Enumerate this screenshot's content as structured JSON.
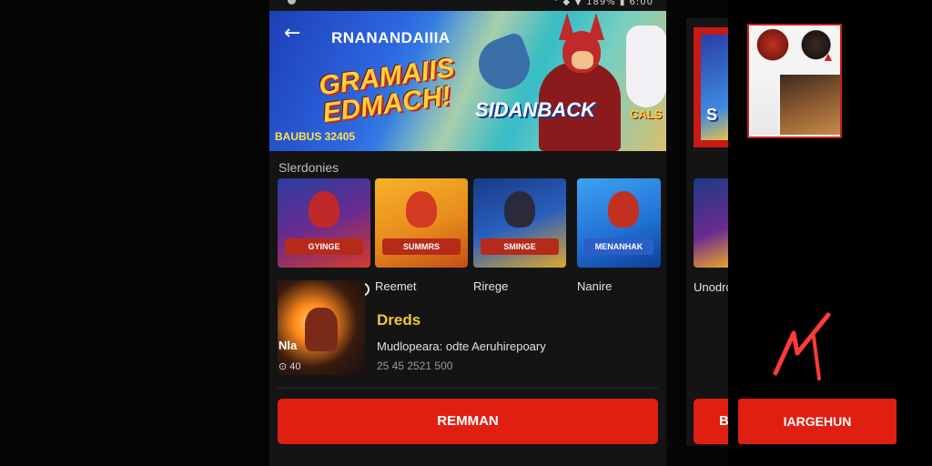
{
  "status_bar": {
    "right_text": "° ◆ ▼ 189% ▮ 6:00"
  },
  "header": {
    "back_icon": "arrow-left-icon",
    "title": "RNANANDAIIIA"
  },
  "banner": {
    "logo_left": "GRAMAIIS\nEDMACH!",
    "logo_right": "SIDANBACK",
    "logo_tag": "CALS",
    "subtitle": "BAUBUS 32405"
  },
  "section": {
    "label": "Slerdonies"
  },
  "games": [
    {
      "badge": "GYINGE",
      "label": "Reemet"
    },
    {
      "badge": "SUMMRS",
      "label": "Rirege"
    },
    {
      "badge": "SMINGE",
      "label": "Nanire"
    },
    {
      "badge": "MENANHAK",
      "label": ""
    }
  ],
  "featured": {
    "title": "Dreds",
    "description": "Mudlopeara: odte Aeruhirepoary",
    "meta": "25 45 2521 500",
    "side_letter": "Nla",
    "side_meta": "⊙ 40"
  },
  "primary_button": {
    "label": "REMMAN"
  },
  "side_card": {
    "banner_letter": "S",
    "tile_label": "Unodrc",
    "button_letter": "B"
  },
  "right_panel": {
    "button_label": "IARGEHUN"
  },
  "colors": {
    "accent": "#e01f13",
    "title_yellow": "#f2c531",
    "background": "#141414"
  }
}
